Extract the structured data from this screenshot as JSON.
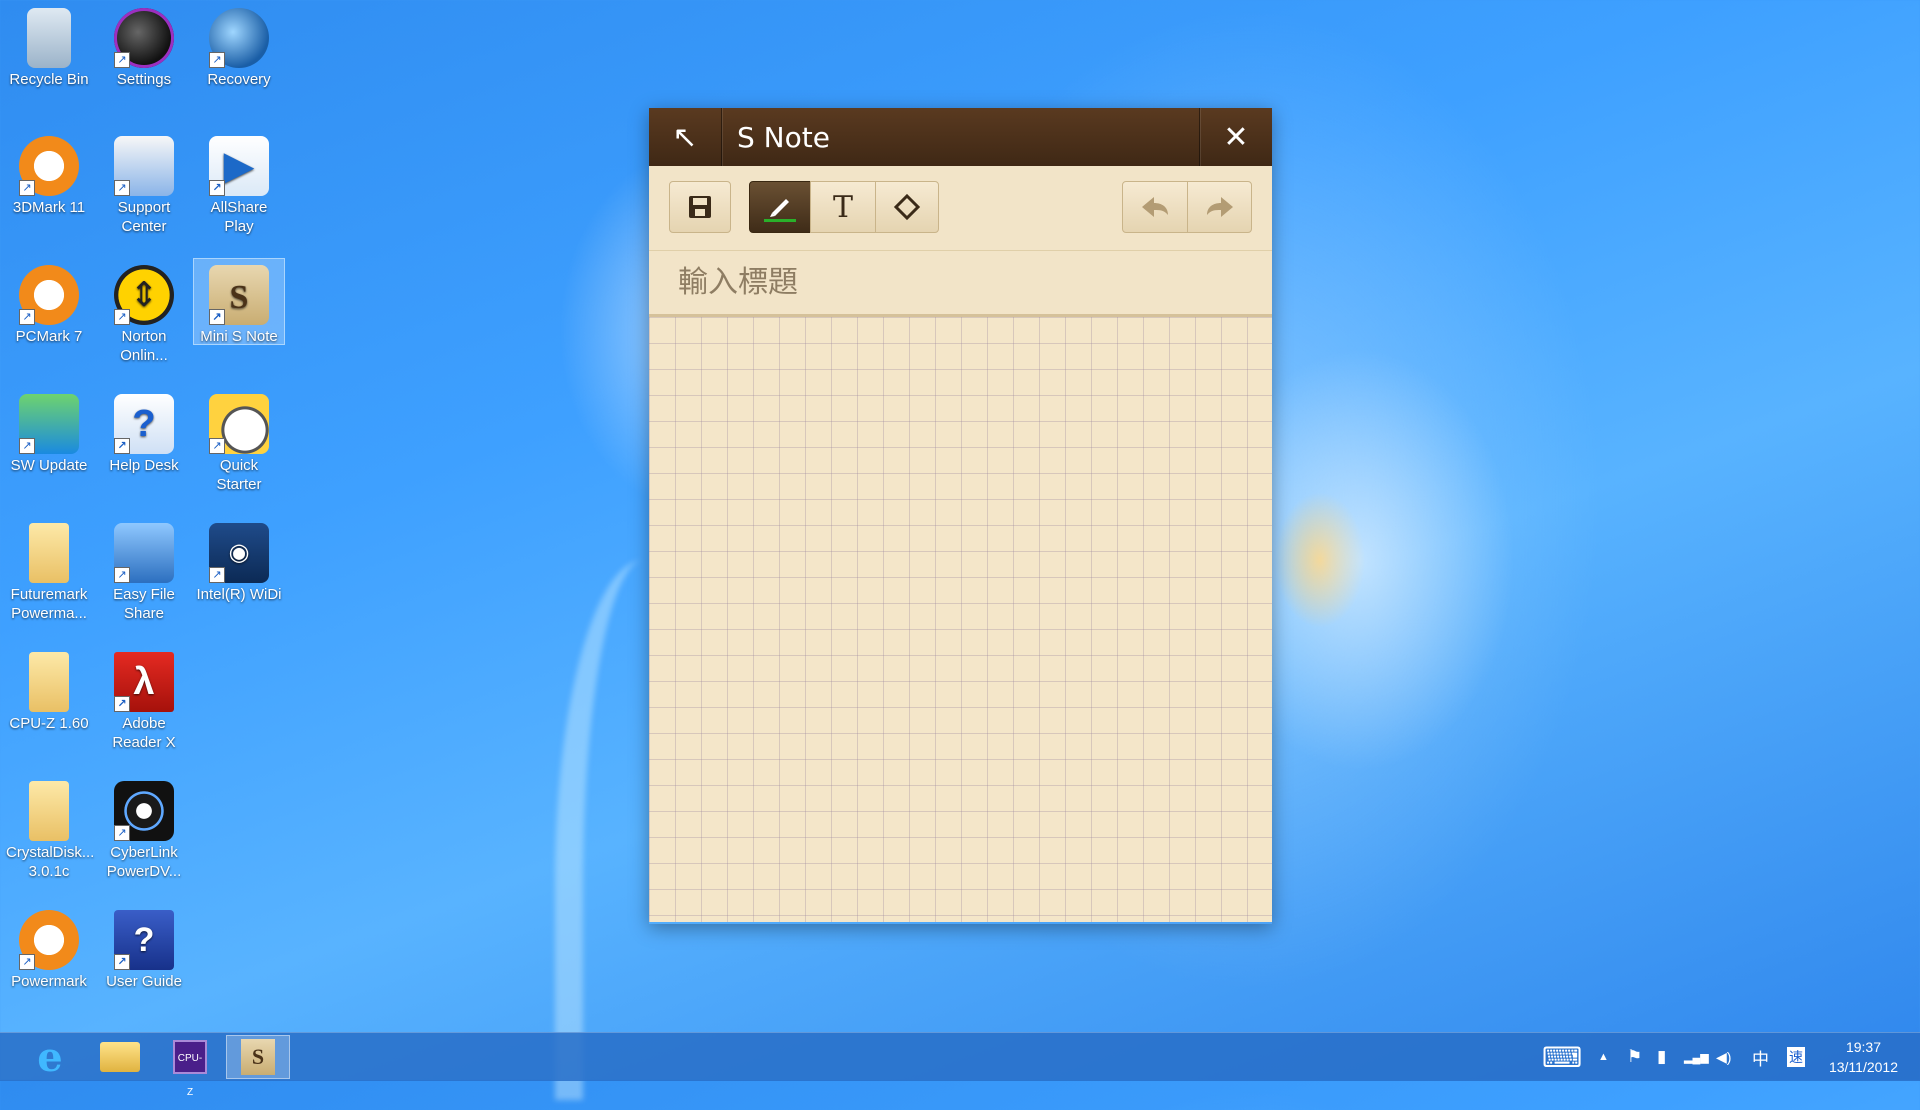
{
  "desktop": {
    "icons": [
      {
        "label": "Recycle Bin",
        "glyph": "",
        "shortcut": false
      },
      {
        "label": "Settings",
        "glyph": "",
        "shortcut": true
      },
      {
        "label": "Recovery",
        "glyph": "",
        "shortcut": true
      },
      {
        "label": "3DMark 11",
        "glyph": "",
        "shortcut": true
      },
      {
        "label": "Support Center",
        "glyph": "",
        "shortcut": true
      },
      {
        "label": "AllShare Play",
        "glyph": "▶",
        "shortcut": true
      },
      {
        "label": "PCMark 7",
        "glyph": "",
        "shortcut": true
      },
      {
        "label": "Norton Onlin...",
        "glyph": "⇕",
        "shortcut": true
      },
      {
        "label": "Mini S Note",
        "glyph": "S",
        "shortcut": true
      },
      {
        "label": "SW Update",
        "glyph": "",
        "shortcut": true
      },
      {
        "label": "Help Desk",
        "glyph": "?",
        "shortcut": true
      },
      {
        "label": "Quick Starter",
        "glyph": "",
        "shortcut": true
      },
      {
        "label": "Futuremark Powerma...",
        "glyph": "",
        "shortcut": false
      },
      {
        "label": "Easy File Share",
        "glyph": "",
        "shortcut": true
      },
      {
        "label": "Intel(R) WiDi",
        "glyph": "◉",
        "shortcut": true
      },
      {
        "label": "CPU-Z 1.60",
        "glyph": "",
        "shortcut": false
      },
      {
        "label": "Adobe Reader X",
        "glyph": "λ",
        "shortcut": true
      },
      {
        "label": "CrystalDisk... 3.0.1c",
        "glyph": "",
        "shortcut": false
      },
      {
        "label": "CyberLink PowerDV...",
        "glyph": "",
        "shortcut": true
      },
      {
        "label": "Powermark",
        "glyph": "",
        "shortcut": true
      },
      {
        "label": "User Guide",
        "glyph": "?",
        "shortcut": true
      }
    ]
  },
  "snote": {
    "title": "S Note",
    "back_icon": "↖",
    "close_icon": "✕",
    "toolbar": {
      "save_icon": "💾",
      "pen_icon": "✎",
      "text_icon": "T",
      "eraser_icon": "◇",
      "undo_icon": "◄",
      "redo_icon": "►"
    },
    "title_placeholder": "輸入標題",
    "title_value": ""
  },
  "taskbar": {
    "apps": [
      {
        "name": "internet-explorer",
        "glyph": "e"
      },
      {
        "name": "file-explorer",
        "glyph": ""
      },
      {
        "name": "cpu-z",
        "glyph": "CPU-Z"
      },
      {
        "name": "s-note",
        "glyph": "S"
      }
    ],
    "tray": {
      "keyboard_icon": "⌨",
      "chevron_icon": "▲",
      "flag_icon": "⚑",
      "battery_icon": "▮",
      "network_icon": "▂▄▆",
      "volume_icon": "◀)",
      "ime_label": "中",
      "ime_mode": "速"
    },
    "clock": {
      "time": "19:37",
      "date": "13/11/2012"
    }
  }
}
